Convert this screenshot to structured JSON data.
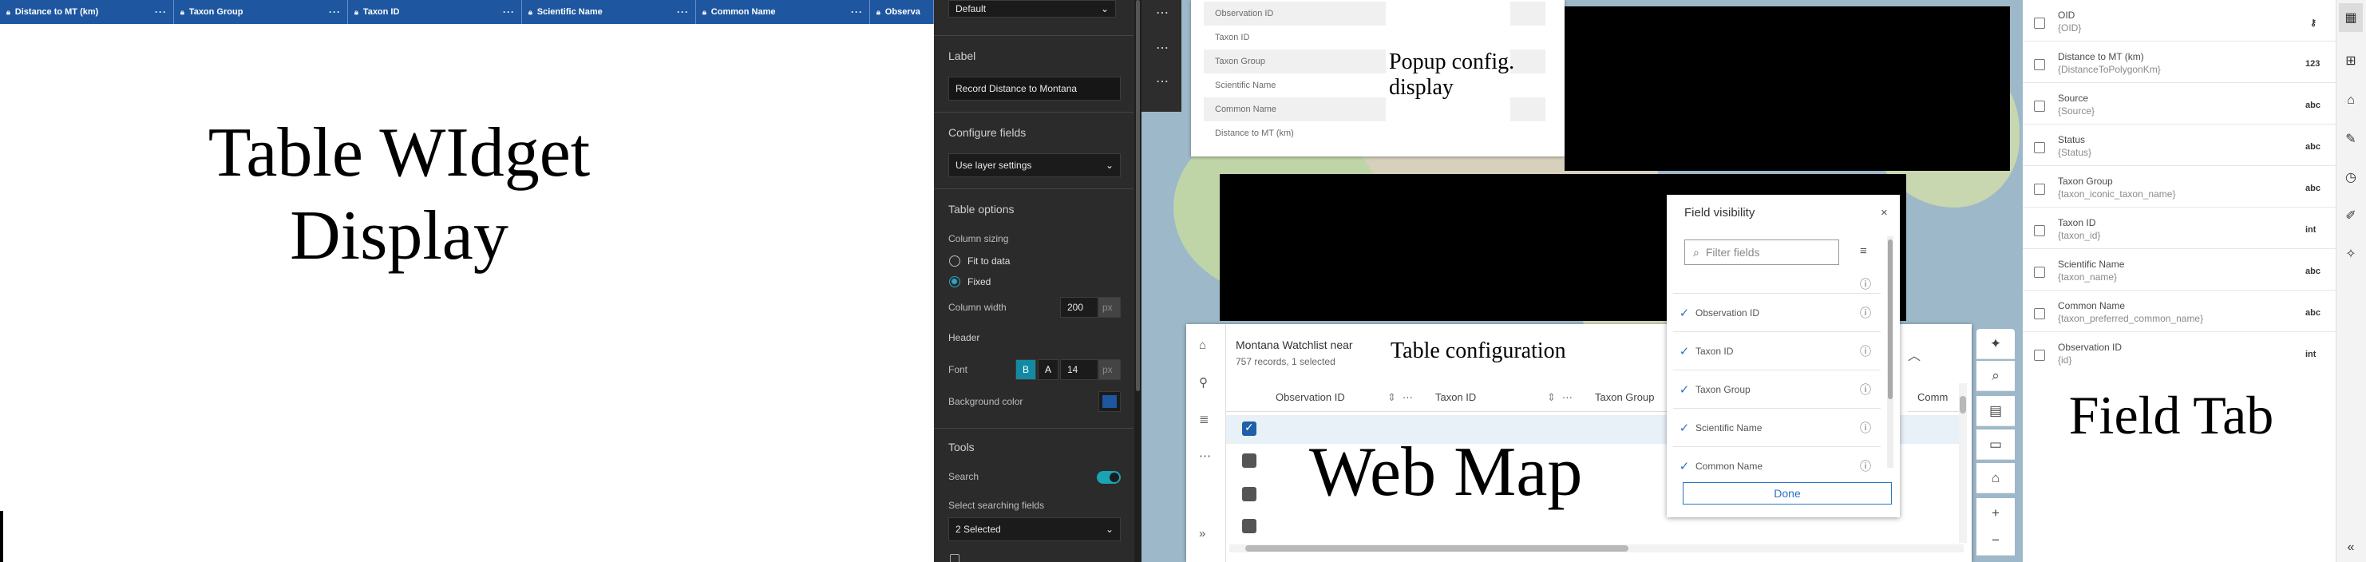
{
  "table_widget": {
    "columns": [
      "Distance to MT (km)",
      "Taxon Group",
      "Taxon ID",
      "Scientific Name",
      "Common Name",
      "Observa"
    ],
    "lock_icon": "lock-icon",
    "more_icon": "more-horizontal-icon",
    "caption_line1": "Table WIdget",
    "caption_line2": "Display",
    "header_color": "#1e56a0"
  },
  "settings": {
    "top_select": "Default",
    "label_title": "Label",
    "label_value": "Record Distance to Montana",
    "configure_fields_title": "Configure fields",
    "configure_fields_value": "Use layer settings",
    "table_options_title": "Table options",
    "column_sizing_label": "Column sizing",
    "fit_to_data": "Fit to data",
    "fixed": "Fixed",
    "column_width_label": "Column width",
    "column_width_value": "200",
    "px_unit": "px",
    "header_label": "Header",
    "font_label": "Font",
    "font_size_value": "14",
    "bold_glyph": "B",
    "color_glyph": "A",
    "background_color_label": "Background color",
    "background_color": "#1e56a0",
    "tools_title": "Tools",
    "search_label": "Search",
    "search_enabled": true,
    "select_search_label": "Select searching fields",
    "select_search_value": "2 Selected"
  },
  "popup": {
    "fields": [
      "Observation ID",
      "Taxon ID",
      "Taxon Group",
      "Scientific Name",
      "Common Name",
      "Distance to MT (km)"
    ],
    "caption_line1": "Popup config.",
    "caption_line2": "display"
  },
  "table_panel": {
    "title": "Montana Watchlist near",
    "subtitle": "757 records, 1 selected",
    "caption": "Table configuration",
    "headers": [
      "Observation ID",
      "Taxon ID",
      "Taxon Group",
      "Comm"
    ],
    "rows_checked": [
      true,
      false,
      false,
      false
    ],
    "map_caption": "Web Map",
    "expand_glyph": "»"
  },
  "field_visibility": {
    "title": "Field visibility",
    "filter_placeholder": "Filter fields",
    "fields": [
      {
        "name": "Observation ID",
        "checked": true
      },
      {
        "name": "Taxon ID",
        "checked": true
      },
      {
        "name": "Taxon Group",
        "checked": true
      },
      {
        "name": "Scientific Name",
        "checked": true
      },
      {
        "name": "Common Name",
        "checked": true
      }
    ],
    "done_label": "Done"
  },
  "field_tab": {
    "fields": [
      {
        "name": "OID",
        "alias": "{OID}",
        "type": "key"
      },
      {
        "name": "Distance to MT (km)",
        "alias": "{DistanceToPolygonKm}",
        "type": "123"
      },
      {
        "name": "Source",
        "alias": "{Source}",
        "type": "abc"
      },
      {
        "name": "Status",
        "alias": "{Status}",
        "type": "abc"
      },
      {
        "name": "Taxon Group",
        "alias": "{taxon_iconic_taxon_name}",
        "type": "abc"
      },
      {
        "name": "Taxon ID",
        "alias": "{taxon_id}",
        "type": "int"
      },
      {
        "name": "Scientific Name",
        "alias": "{taxon_name}",
        "type": "abc"
      },
      {
        "name": "Common Name",
        "alias": "{taxon_preferred_common_name}",
        "type": "abc"
      },
      {
        "name": "Observation ID",
        "alias": "{id}",
        "type": "int"
      }
    ],
    "caption": "Field Tab"
  }
}
